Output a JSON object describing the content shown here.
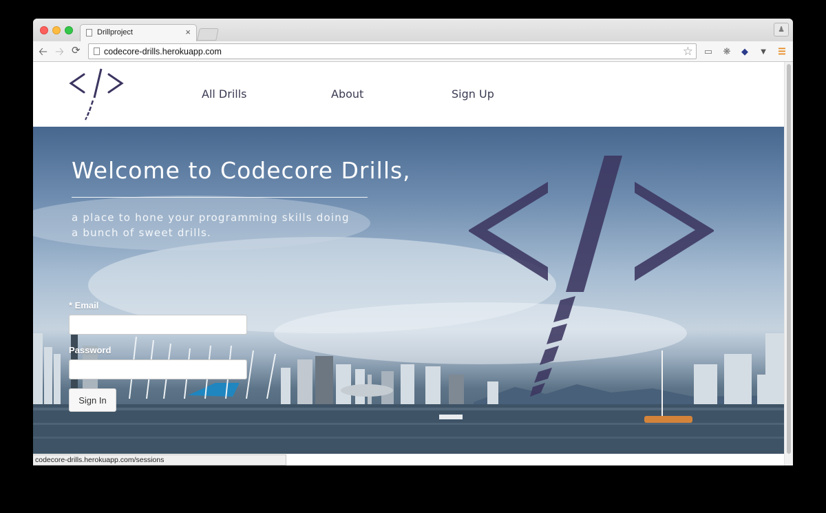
{
  "browser": {
    "tab_title": "Drillproject",
    "tab_close": "×",
    "url": "codecore-drills.herokuapp.com",
    "status_url": "codecore-drills.herokuapp.com/sessions",
    "icons": {
      "back": "back-arrow-icon",
      "forward": "forward-arrow-icon",
      "reload": "reload-icon",
      "bookmark": "star-icon",
      "cast": "cast-icon",
      "bug": "bug-icon",
      "shield": "shield-icon",
      "pocket": "pocket-icon",
      "menu": "menu-icon",
      "profile": "profile-icon"
    }
  },
  "site": {
    "logo": "code-drill-logo",
    "nav": [
      {
        "label": "All Drills"
      },
      {
        "label": "About"
      },
      {
        "label": "Sign Up"
      }
    ]
  },
  "hero": {
    "title": "Welcome to Codecore Drills,",
    "subtitle": "a place to hone your programming skills doing a bunch of sweet drills."
  },
  "login_form": {
    "email_label": "* Email",
    "email_value": "",
    "password_label": "Password",
    "password_value": "",
    "submit_label": "Sign In"
  },
  "colors": {
    "brand_purple": "#3b3560",
    "nav_text": "#3a3a52",
    "sky_top": "#47678e",
    "water": "#3f5467"
  }
}
